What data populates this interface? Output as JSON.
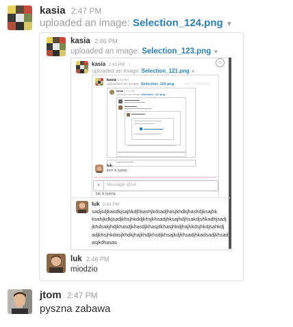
{
  "messages": [
    {
      "user": "kasia",
      "time": "2:47 PM",
      "action": "uploaded an image:",
      "file": "Selection_124.png"
    },
    {
      "user": "jtom",
      "time": "2:47 PM",
      "text": "pyszna zabawa"
    }
  ],
  "nested1": {
    "user": "kasia",
    "time": "2:46 PM",
    "action": "uploaded an image:",
    "file": "Selection_123.png",
    "reply": {
      "user": "luk",
      "time": "2:46 PM",
      "text": "miodzio"
    }
  },
  "nested2": {
    "user": "kasia",
    "time": "2:43 PM",
    "action": "uploaded an image:",
    "file": "Selection_121.png",
    "add_comment": "Add Comment",
    "input_placeholder": "Message @luk",
    "typing": "luk is typing",
    "reply": {
      "user": "luk",
      "time": "2:43 PM",
      "lines": [
        "sadjsdjkasdkjsajhkdjhkashjkdsadjhasjkhdkjhashdjksajhk",
        "ksahjkdkjsadjkhsjhkddjkhsjkhsadjhksajhdjhsakdjshkadhjsadj",
        "jkhdsakjhdjkhasdjkhasdjkhasjdkhasjhkdjhajhkdsjhkdjsahkdj",
        "adjkhsjhkdasjkhdkjhajkhdjkhsdjkhsajkdjkhsadjhkadsadjkhsad",
        "asjkdhasas"
      ]
    }
  },
  "nested3": {
    "user": "kasia",
    "time": "2:43 PM",
    "action": "uploaded an image:",
    "file": "Selection_120.png",
    "typing": "jtom is typing",
    "reply_user": "luk"
  },
  "nested4": {
    "user": "kasia",
    "time": "2:42 PM",
    "action": "uploaded an image:",
    "file": "Selection_117.png"
  }
}
